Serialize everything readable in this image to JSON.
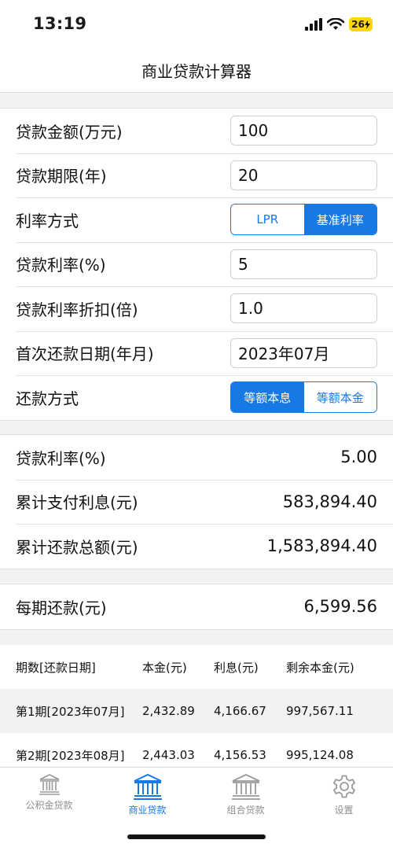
{
  "status_bar": {
    "time": "13:19",
    "battery": "26"
  },
  "nav": {
    "title": "商业贷款计算器"
  },
  "inputs": {
    "loan_amount": {
      "label": "贷款金额(万元)",
      "value": "100"
    },
    "loan_term": {
      "label": "贷款期限(年)",
      "value": "20"
    },
    "rate_mode": {
      "label": "利率方式",
      "options": [
        "LPR",
        "基准利率"
      ],
      "selected": "基准利率"
    },
    "loan_rate": {
      "label": "贷款利率(%)",
      "value": "5"
    },
    "rate_discount": {
      "label": "贷款利率折扣(倍)",
      "value": "1.0"
    },
    "first_date": {
      "label": "首次还款日期(年月)",
      "value": "2023年07月"
    },
    "repay_mode": {
      "label": "还款方式",
      "options": [
        "等额本息",
        "等额本金"
      ],
      "selected": "等额本息"
    }
  },
  "results": {
    "rate": {
      "label": "贷款利率(%)",
      "value": "5.00"
    },
    "interest": {
      "label": "累计支付利息(元)",
      "value": "583,894.40"
    },
    "total": {
      "label": "累计还款总额(元)",
      "value": "1,583,894.40"
    }
  },
  "monthly": {
    "label": "每期还款(元)",
    "value": "6,599.56"
  },
  "schedule": {
    "headers": [
      "期数[还款日期]",
      "本金(元)",
      "利息(元)",
      "剩余本金(元)"
    ],
    "rows": [
      [
        "第1期[2023年07月]",
        "2,432.89",
        "4,166.67",
        "997,567.11"
      ],
      [
        "第2期[2023年08月]",
        "2,443.03",
        "4,156.53",
        "995,124.08"
      ]
    ]
  },
  "tabs": [
    {
      "label": "公积金贷款",
      "icon": "bank-icon",
      "active": false
    },
    {
      "label": "商业贷款",
      "icon": "bank-icon",
      "active": true
    },
    {
      "label": "组合贷款",
      "icon": "bank-icon",
      "active": false
    },
    {
      "label": "设置",
      "icon": "gear-icon",
      "active": false
    }
  ],
  "colors": {
    "accent": "#1779e3",
    "background": "#f2f2f4",
    "stripe": "#f2f2f4",
    "battery": "#ffd60a"
  }
}
